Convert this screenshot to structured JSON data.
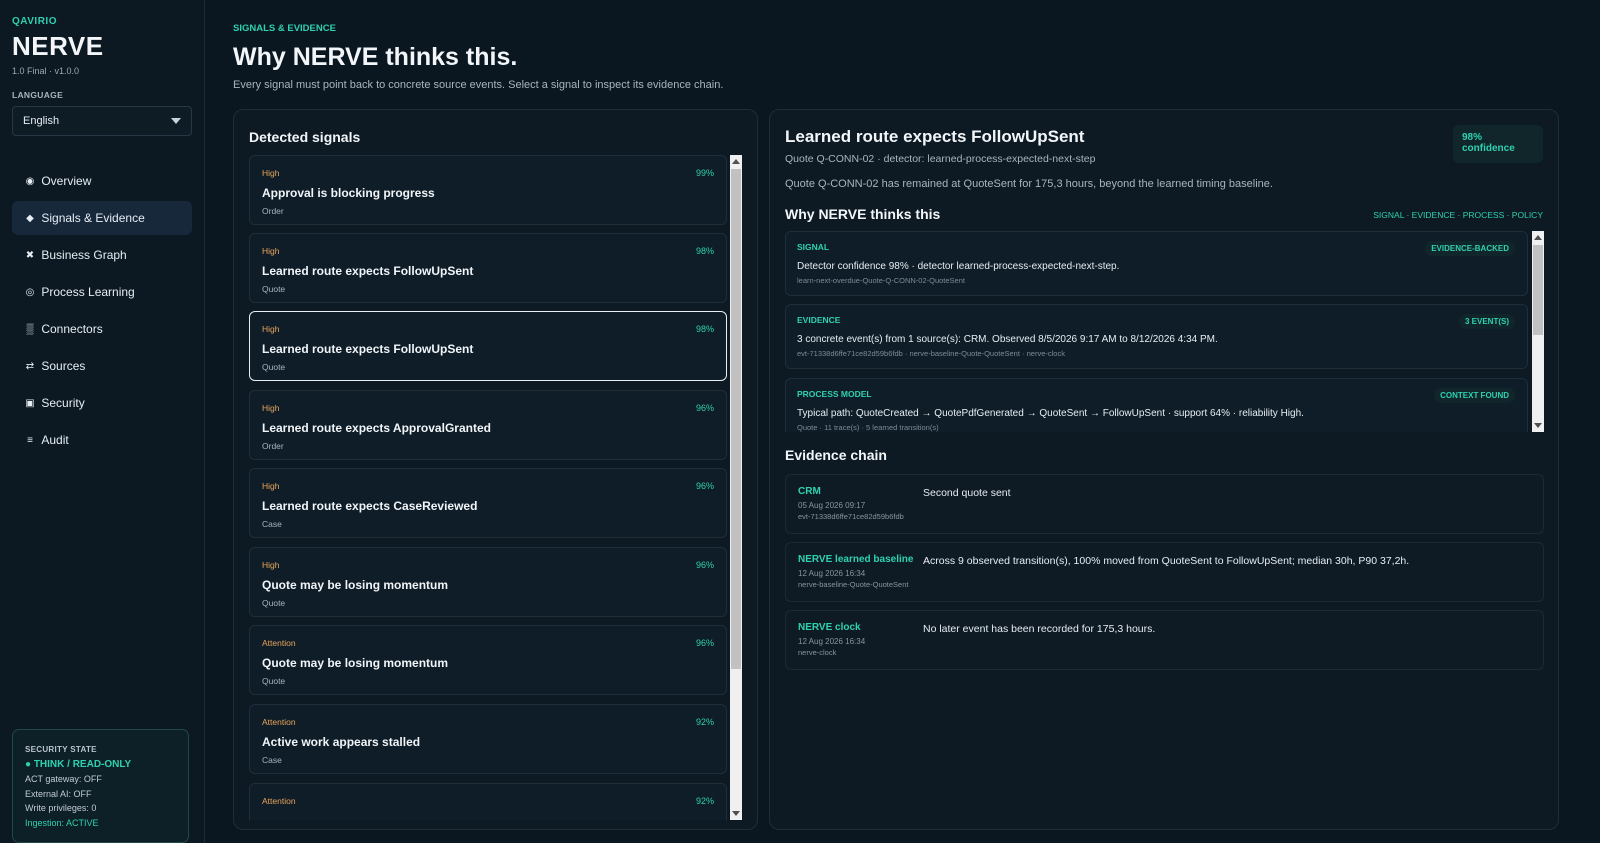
{
  "app": {
    "brand": "QAVIRIO",
    "name": "NERVE",
    "version": "1.0 Final · v1.0.0",
    "language_label": "LANGUAGE",
    "language_value": "English"
  },
  "nav": [
    {
      "icon": "◉",
      "label": "Overview"
    },
    {
      "icon": "◆",
      "label": "Signals & Evidence"
    },
    {
      "icon": "✖",
      "label": "Business Graph"
    },
    {
      "icon": "◎",
      "label": "Process Learning"
    },
    {
      "icon": "▒",
      "label": "Connectors"
    },
    {
      "icon": "⇄",
      "label": "Sources"
    },
    {
      "icon": "▣",
      "label": "Security"
    },
    {
      "icon": "≡",
      "label": "Audit"
    }
  ],
  "security": {
    "title": "SECURITY STATE",
    "state": "● THINK / READ-ONLY",
    "act_gateway": "ACT gateway: OFF",
    "external_ai": "External AI: OFF",
    "write_privileges": "Write privileges: 0",
    "ingestion": "Ingestion: ACTIVE"
  },
  "header": {
    "kicker": "SIGNALS & EVIDENCE",
    "title": "Why NERVE thinks this.",
    "subtitle": "Every signal must point back to concrete source events. Select a signal to inspect its evidence chain."
  },
  "signals": {
    "title": "Detected signals",
    "items": [
      {
        "severity": "High",
        "confidence": "99%",
        "title": "Approval is blocking progress",
        "type": "Order"
      },
      {
        "severity": "High",
        "confidence": "98%",
        "title": "Learned route expects FollowUpSent",
        "type": "Quote"
      },
      {
        "severity": "High",
        "confidence": "98%",
        "title": "Learned route expects FollowUpSent",
        "type": "Quote"
      },
      {
        "severity": "High",
        "confidence": "96%",
        "title": "Learned route expects ApprovalGranted",
        "type": "Order"
      },
      {
        "severity": "High",
        "confidence": "96%",
        "title": "Learned route expects CaseReviewed",
        "type": "Case"
      },
      {
        "severity": "High",
        "confidence": "96%",
        "title": "Quote may be losing momentum",
        "type": "Quote"
      },
      {
        "severity": "Attention",
        "confidence": "96%",
        "title": "Quote may be losing momentum",
        "type": "Quote"
      },
      {
        "severity": "Attention",
        "confidence": "92%",
        "title": "Active work appears stalled",
        "type": "Case"
      },
      {
        "severity": "Attention",
        "confidence": "92%",
        "title": "",
        "type": ""
      }
    ]
  },
  "detail": {
    "title": "Learned route expects FollowUpSent",
    "confidence": "98% confidence",
    "meta": "Quote Q-CONN-02 · detector: learned-process-expected-next-step",
    "description": "Quote Q-CONN-02 has remained at QuoteSent for 175,3 hours, beyond the learned timing baseline.",
    "why_title": "Why NERVE thinks this",
    "why_tabs": "SIGNAL · EVIDENCE · PROCESS · POLICY",
    "why_cards": [
      {
        "label": "SIGNAL",
        "badge": "EVIDENCE-BACKED",
        "text": "Detector confidence 98% · detector learned-process-expected-next-step.",
        "sub": "learn-next-overdue-Quote-Q-CONN-02-QuoteSent"
      },
      {
        "label": "EVIDENCE",
        "badge": "3 EVENT(S)",
        "text": "3 concrete event(s) from 1 source(s): CRM. Observed 8/5/2026 9:17 AM to 8/12/2026 4:34 PM.",
        "sub": "evt-71338d6ffe71ce82d59b6fdb · nerve-baseline-Quote-QuoteSent · nerve-clock"
      },
      {
        "label": "PROCESS MODEL",
        "badge": "CONTEXT FOUND",
        "text": "Typical path: QuoteCreated → QuotePdfGenerated → QuoteSent → FollowUpSent · support 64% · reliability High.",
        "sub": "Quote · 11 trace(s) · 5 learned transition(s)"
      }
    ],
    "chain_title": "Evidence chain",
    "chain": [
      {
        "source": "CRM",
        "date": "05 Aug 2026 09:17",
        "id": "evt-71338d6ffe71ce82d59b6fdb",
        "text": "Second quote sent"
      },
      {
        "source": "NERVE learned baseline",
        "date": "12 Aug 2026 16:34",
        "id": "nerve-baseline-Quote-QuoteSent",
        "text": "Across 9 observed transition(s), 100% moved from QuoteSent to FollowUpSent; median 30h, P90 37,2h."
      },
      {
        "source": "NERVE clock",
        "date": "12 Aug 2026 16:34",
        "id": "nerve-clock",
        "text": "No later event has been recorded for 175,3 hours."
      }
    ]
  }
}
